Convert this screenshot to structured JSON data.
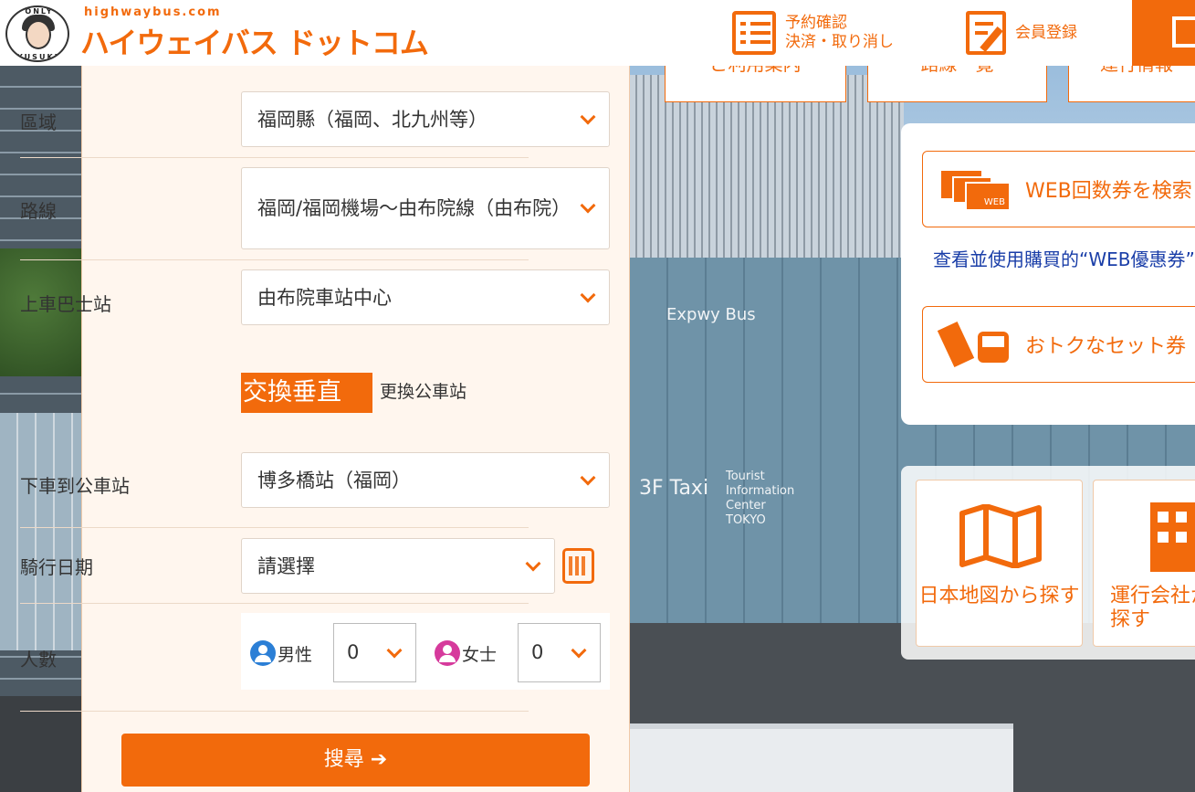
{
  "header": {
    "logo_sub": "highwaybus.com",
    "logo_main": "ハイウェイバス ドットコム",
    "logo_badge_top": "ONLY",
    "logo_badge_bottom": "YUSUKE",
    "reserve_line1": "予約確認",
    "reserve_line2": "決済・取り消し",
    "member_register": "会員登録"
  },
  "top_tabs": [
    "ご利用案内",
    "路線一覧",
    "運行情報"
  ],
  "search": {
    "area_label": "區域",
    "area_value": "福岡縣（福岡、北九州等）",
    "route_label": "路線",
    "route_value": "福岡/福岡機場～由布院線（由布院）",
    "board_label": "上車巴士站",
    "board_value": "由布院車站中心",
    "swap_button": "交換垂直",
    "swap_text": "更換公車站",
    "alight_label": "下車到公車站",
    "alight_value": "博多橋站（福岡）",
    "date_label": "騎行日期",
    "date_value": "請選擇",
    "pax_label": "人數",
    "male_label": "男性",
    "male_count": "0",
    "female_label": "女士",
    "female_count": "0",
    "search_button": "搜尋 ➔"
  },
  "card": {
    "web_ticket": "WEB回数券を検索",
    "web_ticket_icon_text": "WEB",
    "web_link": "查看並使用購買的“WEB優惠券”",
    "set_ticket": "おトクなセット券"
  },
  "grid": {
    "map_search": "日本地図から探す",
    "company_search": "運行会社から探す"
  },
  "background_signs": {
    "expressway": "Expwy Bus",
    "taxi": "3F Taxi",
    "tourist": "Tourist",
    "information": "Information",
    "center": "Center",
    "tokyo": "TOKYO"
  },
  "colors": {
    "brand": "#f26a0c",
    "panel_bg": "#fff6ee",
    "link": "#1a3ea8",
    "male": "#2b7fd6",
    "female": "#d63a9c"
  }
}
